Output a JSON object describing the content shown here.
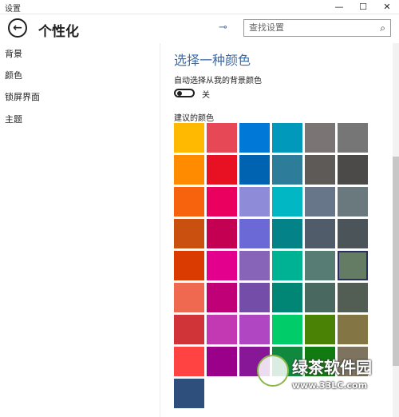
{
  "window": {
    "title": "设置",
    "minimize_glyph": "—",
    "maximize_glyph": "☐",
    "close_glyph": "✕"
  },
  "header": {
    "back_glyph": "←",
    "page_title": "个性化",
    "pin_glyph": "⊸",
    "search_placeholder": "查找设置",
    "search_glyph": "⌕"
  },
  "sidebar": {
    "items": [
      {
        "label": "背景"
      },
      {
        "label": "颜色"
      },
      {
        "label": "锁屏界面"
      },
      {
        "label": "主题"
      }
    ]
  },
  "main": {
    "section_title": "选择一种颜色",
    "auto_pick_label": "自动选择从我的背景颜色",
    "toggle_state_label": "关",
    "recommended_label": "建议的颜色",
    "swatches": [
      "#FFB900",
      "#E74856",
      "#0078D7",
      "#0099BC",
      "#7A7574",
      "#767676",
      "#FF8C00",
      "#E81123",
      "#0063B1",
      "#2D7D9A",
      "#5D5A58",
      "#4C4A48",
      "#F7630C",
      "#EA005E",
      "#8E8CD8",
      "#00B7C3",
      "#68768A",
      "#69797E",
      "#CA5010",
      "#C30052",
      "#6B69D6",
      "#038387",
      "#515C6B",
      "#4A5459",
      "#DA3B01",
      "#E3008C",
      "#8764B8",
      "#00B294",
      "#567C73",
      "#647C64",
      "#EF6950",
      "#BF0077",
      "#744DA9",
      "#018574",
      "#486860",
      "#525E54",
      "#D13438",
      "#C239B3",
      "#B146C2",
      "#00CC6A",
      "#498205",
      "#847545",
      "#FF4343",
      "#9A0089",
      "#881798",
      "#10893E",
      "#107C10",
      "#7E735F",
      "#2E4F7C"
    ],
    "selected_swatch": "#647C64"
  },
  "watermark": {
    "text": "绿茶软件园",
    "url": "www.33LC.com"
  }
}
